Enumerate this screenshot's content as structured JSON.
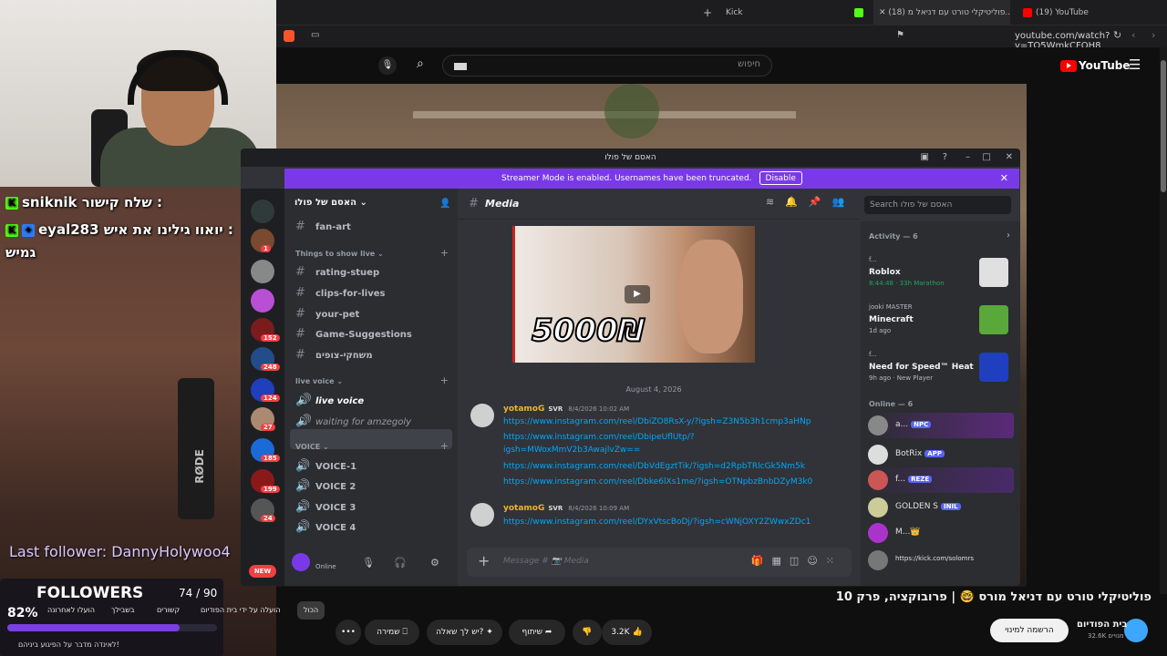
{
  "browser": {
    "tabs": [
      {
        "label": "(19) YouTube",
        "fav": "#ff0000"
      },
      {
        "label": "(18) פוליטיקלי טורט עם דניאל מ...",
        "fav": "#ff0000"
      },
      {
        "label": "Kick",
        "fav": "#53fc18"
      }
    ],
    "url": "youtube.com/watch?v=TO5WmkCFOH8"
  },
  "youtube": {
    "search_placeholder": "חיפוש",
    "logo": "YouTube",
    "video_title": "פוליטיקלי טורט עם דניאל מורס 🤓 | פרובוקציה, פרק 10",
    "channel_name": "בית הפודיום",
    "channel_subs": "32.6K מנויים",
    "subscribe_label": "הרשמה למינוי",
    "likes": "3.2K",
    "share_label": "שיתוף",
    "ask_label": "יש לך שאלה?",
    "save_label": "שמירה",
    "more_label": "•••"
  },
  "stream_overlay": {
    "chat": [
      {
        "user": "sniknik",
        "text": "שלח קישור :"
      },
      {
        "user": "eyal283",
        "text": "יואוו גילינו את איש :",
        "text2": "גמיש"
      }
    ],
    "last_follower_label": "Last follower: DannyHolywoo4",
    "followers_label": "FOLLOWERS",
    "followers_count": "74 / 90",
    "followers_pct_label": "82%",
    "followers_pct": 0.82,
    "mic_brand": "RØDE",
    "chips": [
      "הכול",
      "הועלה על ידי בית הפודיום",
      "קשורים",
      "בשבילך",
      "הועלו לאחרונה"
    ],
    "bottom_text": "לאינדה מדבר על הפיגוע ביניהם!"
  },
  "discord": {
    "window_title": "האסם של פולו",
    "streamer_banner": "Streamer Mode is enabled. Usernames have been truncated.",
    "disable_label": "Disable",
    "server_name": "האסם של פולו",
    "channels": {
      "top": "fan-art",
      "cat1": "Things to show live",
      "cat1_items": [
        "rating-stuep",
        "clips-for-lives",
        "your-pet",
        "Game-Suggestions",
        "משחקי-צופים"
      ],
      "cat2": "live voice",
      "cat2_items": [
        "live voice",
        "waiting for amzegoly"
      ],
      "cat3": "VOICE",
      "cat3_items": [
        "VOICE-1",
        "VOICE 2",
        "VOICE 3",
        "VOICE 4"
      ]
    },
    "guild_badges": [
      "1",
      "152",
      "248",
      "124",
      "27",
      "185",
      "199",
      "24"
    ],
    "new_label": "NEW",
    "user_status": "Online",
    "chat_channel": "Media",
    "thumb_text": "5000₪",
    "date_sep": "August 4, 2026",
    "messages": [
      {
        "user": "yotamoG",
        "tag": "SVR",
        "time": "8/4/2026 10:02 AM",
        "links": [
          "https://www.instagram.com/reel/DbiZO8RsX-y/?igsh=Z3N5b3h1cmp3aHNp",
          "https://www.instagram.com/reel/DbipeUflUtp/?",
          "igsh=MWoxMmV2b3AwajlvZw==",
          "https://www.instagram.com/reel/DbVdEgztTik/?igsh=d2RpbTRlcGk5Nm5k",
          "https://www.instagram.com/reel/Dbke6lXs1me/?igsh=OTNpbzBnbDZyM3k0"
        ]
      },
      {
        "user": "yotamoG",
        "tag": "SVR",
        "time": "8/4/2026 10:09 AM",
        "links": [
          "https://www.instagram.com/reel/DYxVtscBoDj/?igsh=cWNjOXY2ZWwxZDc1"
        ]
      }
    ],
    "compose_placeholder": "Message # 📷 Media",
    "search_placeholder": "Search האסם של פולו",
    "activity_header": "Activity — 6",
    "activities": [
      {
        "user": "f...",
        "title": "Roblox",
        "sub": "8:44:48 · 33h Marathon",
        "color": "#e0e0e0"
      },
      {
        "user": "jooki MASTER",
        "title": "Minecraft",
        "sub": "1d ago",
        "color": "#5aa83a"
      },
      {
        "user": "f...",
        "title": "Need for Speed™ Heat",
        "sub": "9h ago · New Player",
        "color": "#1f3fbf"
      }
    ],
    "online_header": "Online — 6",
    "members": [
      {
        "name": "a...",
        "badge": "NPC",
        "color": "#888"
      },
      {
        "name": "BotRix",
        "badge": "APP",
        "color": "#ddd"
      },
      {
        "name": "f...",
        "badge": "REZE",
        "color": "#c55"
      },
      {
        "name": "GOLDEN S",
        "badge": "INIL",
        "color": "#cc9"
      },
      {
        "name": "M...",
        "badge": "👑",
        "color": "#aa33cc"
      },
      {
        "name": "https://kick.com/solomrs",
        "badge": "",
        "color": "#777"
      }
    ]
  }
}
